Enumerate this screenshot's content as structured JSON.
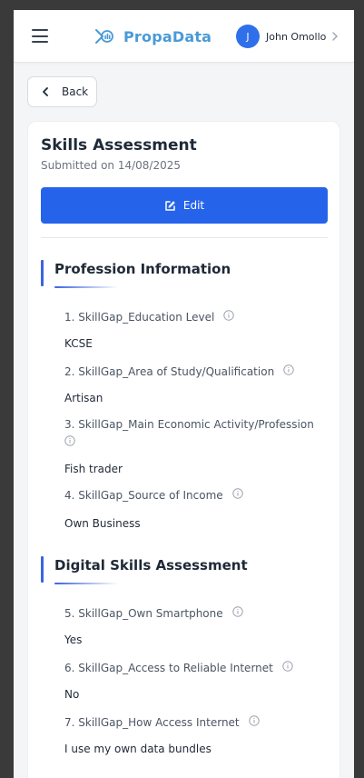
{
  "header": {
    "brand": "PropaData",
    "user_initial": "J",
    "user_name": "John Omollo"
  },
  "back_label": "Back",
  "card": {
    "title": "Skills Assessment",
    "submitted": "Submitted on 14/08/2025",
    "edit_label": "Edit"
  },
  "sections": [
    {
      "title": "Profession Information",
      "questions": [
        {
          "label": "1. SkillGap_Education Level",
          "answer": "KCSE"
        },
        {
          "label": "2. SkillGap_Area of Study/Qualification",
          "answer": "Artisan"
        },
        {
          "label": "3. SkillGap_Main Economic Activity/Profession",
          "answer": "Fish trader"
        },
        {
          "label": "4. SkillGap_Source of Income",
          "answer": "Own Business"
        }
      ]
    },
    {
      "title": "Digital Skills Assessment",
      "questions": [
        {
          "label": "5. SkillGap_Own Smartphone",
          "answer": "Yes"
        },
        {
          "label": "6. SkillGap_Access to Reliable Internet",
          "answer": "No"
        },
        {
          "label": "7. SkillGap_How Access Internet",
          "answer": "I use my own data bundles"
        }
      ]
    }
  ],
  "colors": {
    "primary": "#2563eb",
    "brand": "#4a9ad8",
    "section_accent": "#3b64e0"
  }
}
